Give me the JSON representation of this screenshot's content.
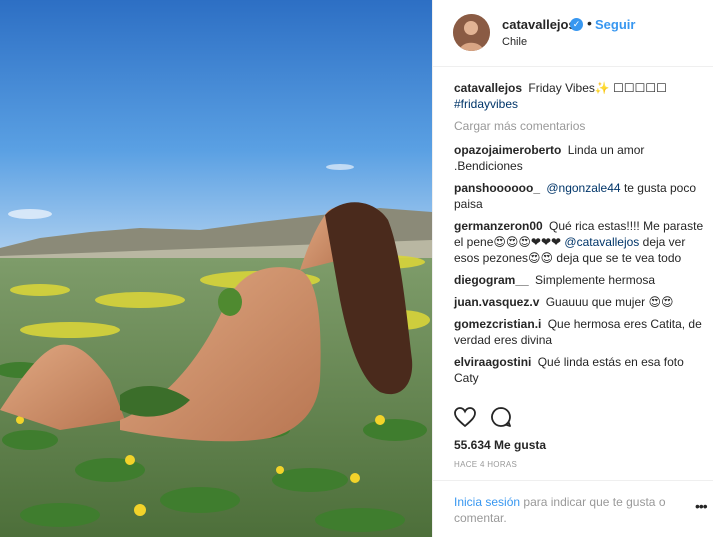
{
  "post": {
    "username": "catavallejos",
    "verified_mark": "✓",
    "separator": "•",
    "follow_label": "Seguir",
    "location": "Chile",
    "caption_user": "catavallejos",
    "caption_text": "Friday Vibes✨ ☐☐☐☐☐",
    "caption_hashtag": "#fridayvibes",
    "load_more": "Cargar más comentarios",
    "comments": [
      {
        "user": "opazojaimeroberto",
        "text": "Linda un amor .Bendiciones"
      },
      {
        "user": "panshoooooo_",
        "mention": "@ngonzale44",
        "text": "te gusta poco paisa"
      },
      {
        "user": "germanzeron00",
        "text": "Qué rica estas!!!! Me paraste el pene😍😍😍❤❤❤",
        "mention": "@catavallejos",
        "text2": "deja ver esos pezones😍😍 deja que se te vea todo"
      },
      {
        "user": "diegogram__",
        "text": "Simplemente hermosa"
      },
      {
        "user": "juan.vasquez.v",
        "text": "Guauuu que mujer 😍😍"
      },
      {
        "user": "gomezcristian.i",
        "text": "Que hermosa eres Catita, de verdad eres divina"
      },
      {
        "user": "elviraagostini",
        "text": "Qué linda estás en esa foto Caty"
      }
    ],
    "likes": "55.634 Me gusta",
    "time_ago": "HACE 4 HORAS",
    "footer_login": "Inicia sesión",
    "footer_text": "para indicar que te gusta o comentar.",
    "more_icon": "•••"
  },
  "icons": {
    "like": "heart-icon",
    "comment": "comment-bubble-icon",
    "more": "more-options-icon"
  },
  "colors": {
    "link_blue": "#3897f0",
    "mention_blue": "#003569",
    "muted": "#999999",
    "text": "#262626"
  }
}
